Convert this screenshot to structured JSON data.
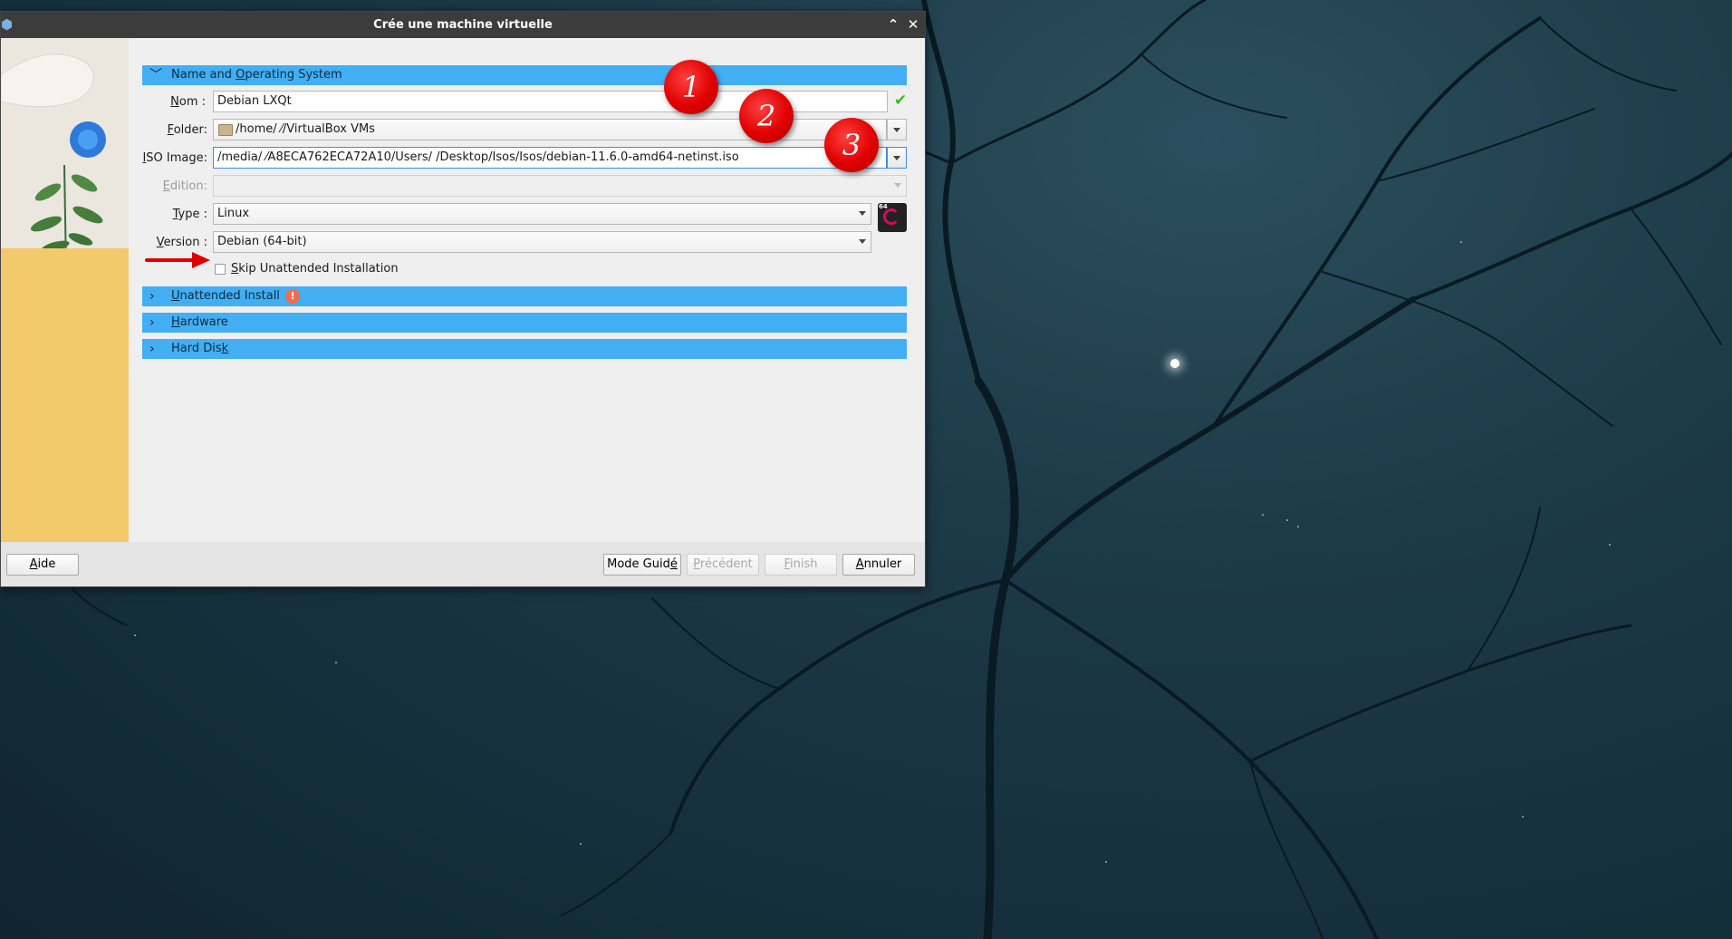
{
  "window": {
    "title": "Crée une machine virtuelle"
  },
  "sections": {
    "name_os": {
      "label_pre": "Name and ",
      "label_mn": "O",
      "label_post": "perating System"
    },
    "unattended": {
      "label_mn": "U",
      "label_post": "nattended Install"
    },
    "hardware": {
      "label_mn": "H",
      "label_post": "ardware"
    },
    "hard_disk": {
      "label_pre": "Hard Dis",
      "label_mn": "k"
    }
  },
  "form": {
    "nom": {
      "label_mn": "N",
      "label_post": "om :",
      "value": "Debian LXQt"
    },
    "folder": {
      "label_mn": "F",
      "label_post": "older:",
      "value": "/home/          ⁄/VirtualBox VMs"
    },
    "iso": {
      "label_mn": "I",
      "label_post": "SO Image:",
      "value": "/media/          ⁄A8ECA762ECA72A10/Users/          /Desktop/Isos/Isos/debian-11.6.0-amd64-netinst.iso"
    },
    "edition": {
      "label_mn": "E",
      "label_post": "dition:",
      "value": ""
    },
    "type": {
      "label_mn": "T",
      "label_post": "ype :",
      "value": "Linux"
    },
    "version": {
      "label_mn": "V",
      "label_post": "ersion :",
      "value": "Debian (64-bit)"
    },
    "skip": {
      "label_mn": "S",
      "label_post": "kip Unattended Installation",
      "checked": false
    },
    "os_icon_bits": "64"
  },
  "buttons": {
    "aide": {
      "mn": "A",
      "post": "ide"
    },
    "mode_guide": {
      "pre": "Mode Guid",
      "mn": "é"
    },
    "precedent": {
      "mn": "P",
      "post": "récédent"
    },
    "finish": {
      "mn": "F",
      "post": "inish"
    },
    "annuler": {
      "mn": "A",
      "post": "nnuler"
    }
  },
  "annotations": {
    "badge1": "1",
    "badge2": "2",
    "badge3": "3"
  },
  "colors": {
    "section_header": "#42aef3",
    "titlebar": "#3c3c3c",
    "valid_check": "#3fb61e",
    "annotation_red": "#e00000"
  }
}
